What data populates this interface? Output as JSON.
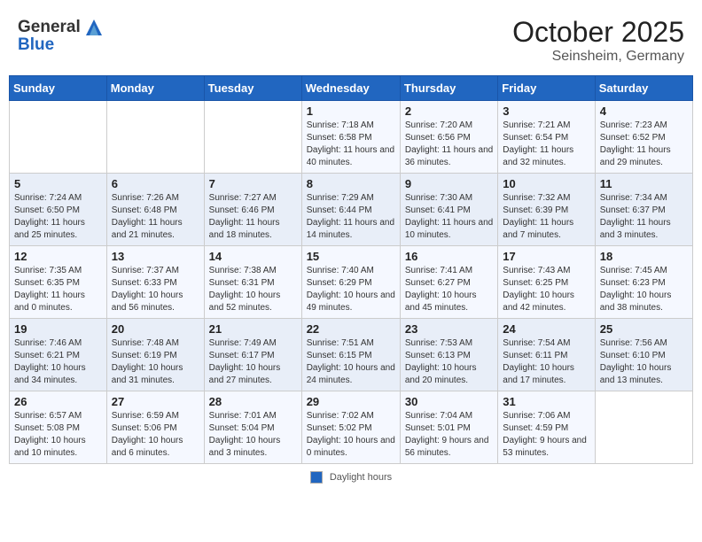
{
  "header": {
    "logo_line1": "General",
    "logo_line2": "Blue",
    "title": "October 2025",
    "subtitle": "Seinsheim, Germany"
  },
  "footer": {
    "legend_label": "Daylight hours"
  },
  "calendar": {
    "days": [
      "Sunday",
      "Monday",
      "Tuesday",
      "Wednesday",
      "Thursday",
      "Friday",
      "Saturday"
    ],
    "weeks": [
      [
        {
          "num": "",
          "info": ""
        },
        {
          "num": "",
          "info": ""
        },
        {
          "num": "",
          "info": ""
        },
        {
          "num": "1",
          "info": "Sunrise: 7:18 AM\nSunset: 6:58 PM\nDaylight: 11 hours and 40 minutes."
        },
        {
          "num": "2",
          "info": "Sunrise: 7:20 AM\nSunset: 6:56 PM\nDaylight: 11 hours and 36 minutes."
        },
        {
          "num": "3",
          "info": "Sunrise: 7:21 AM\nSunset: 6:54 PM\nDaylight: 11 hours and 32 minutes."
        },
        {
          "num": "4",
          "info": "Sunrise: 7:23 AM\nSunset: 6:52 PM\nDaylight: 11 hours and 29 minutes."
        }
      ],
      [
        {
          "num": "5",
          "info": "Sunrise: 7:24 AM\nSunset: 6:50 PM\nDaylight: 11 hours and 25 minutes."
        },
        {
          "num": "6",
          "info": "Sunrise: 7:26 AM\nSunset: 6:48 PM\nDaylight: 11 hours and 21 minutes."
        },
        {
          "num": "7",
          "info": "Sunrise: 7:27 AM\nSunset: 6:46 PM\nDaylight: 11 hours and 18 minutes."
        },
        {
          "num": "8",
          "info": "Sunrise: 7:29 AM\nSunset: 6:44 PM\nDaylight: 11 hours and 14 minutes."
        },
        {
          "num": "9",
          "info": "Sunrise: 7:30 AM\nSunset: 6:41 PM\nDaylight: 11 hours and 10 minutes."
        },
        {
          "num": "10",
          "info": "Sunrise: 7:32 AM\nSunset: 6:39 PM\nDaylight: 11 hours and 7 minutes."
        },
        {
          "num": "11",
          "info": "Sunrise: 7:34 AM\nSunset: 6:37 PM\nDaylight: 11 hours and 3 minutes."
        }
      ],
      [
        {
          "num": "12",
          "info": "Sunrise: 7:35 AM\nSunset: 6:35 PM\nDaylight: 11 hours and 0 minutes."
        },
        {
          "num": "13",
          "info": "Sunrise: 7:37 AM\nSunset: 6:33 PM\nDaylight: 10 hours and 56 minutes."
        },
        {
          "num": "14",
          "info": "Sunrise: 7:38 AM\nSunset: 6:31 PM\nDaylight: 10 hours and 52 minutes."
        },
        {
          "num": "15",
          "info": "Sunrise: 7:40 AM\nSunset: 6:29 PM\nDaylight: 10 hours and 49 minutes."
        },
        {
          "num": "16",
          "info": "Sunrise: 7:41 AM\nSunset: 6:27 PM\nDaylight: 10 hours and 45 minutes."
        },
        {
          "num": "17",
          "info": "Sunrise: 7:43 AM\nSunset: 6:25 PM\nDaylight: 10 hours and 42 minutes."
        },
        {
          "num": "18",
          "info": "Sunrise: 7:45 AM\nSunset: 6:23 PM\nDaylight: 10 hours and 38 minutes."
        }
      ],
      [
        {
          "num": "19",
          "info": "Sunrise: 7:46 AM\nSunset: 6:21 PM\nDaylight: 10 hours and 34 minutes."
        },
        {
          "num": "20",
          "info": "Sunrise: 7:48 AM\nSunset: 6:19 PM\nDaylight: 10 hours and 31 minutes."
        },
        {
          "num": "21",
          "info": "Sunrise: 7:49 AM\nSunset: 6:17 PM\nDaylight: 10 hours and 27 minutes."
        },
        {
          "num": "22",
          "info": "Sunrise: 7:51 AM\nSunset: 6:15 PM\nDaylight: 10 hours and 24 minutes."
        },
        {
          "num": "23",
          "info": "Sunrise: 7:53 AM\nSunset: 6:13 PM\nDaylight: 10 hours and 20 minutes."
        },
        {
          "num": "24",
          "info": "Sunrise: 7:54 AM\nSunset: 6:11 PM\nDaylight: 10 hours and 17 minutes."
        },
        {
          "num": "25",
          "info": "Sunrise: 7:56 AM\nSunset: 6:10 PM\nDaylight: 10 hours and 13 minutes."
        }
      ],
      [
        {
          "num": "26",
          "info": "Sunrise: 6:57 AM\nSunset: 5:08 PM\nDaylight: 10 hours and 10 minutes."
        },
        {
          "num": "27",
          "info": "Sunrise: 6:59 AM\nSunset: 5:06 PM\nDaylight: 10 hours and 6 minutes."
        },
        {
          "num": "28",
          "info": "Sunrise: 7:01 AM\nSunset: 5:04 PM\nDaylight: 10 hours and 3 minutes."
        },
        {
          "num": "29",
          "info": "Sunrise: 7:02 AM\nSunset: 5:02 PM\nDaylight: 10 hours and 0 minutes."
        },
        {
          "num": "30",
          "info": "Sunrise: 7:04 AM\nSunset: 5:01 PM\nDaylight: 9 hours and 56 minutes."
        },
        {
          "num": "31",
          "info": "Sunrise: 7:06 AM\nSunset: 4:59 PM\nDaylight: 9 hours and 53 minutes."
        },
        {
          "num": "",
          "info": ""
        }
      ]
    ]
  }
}
